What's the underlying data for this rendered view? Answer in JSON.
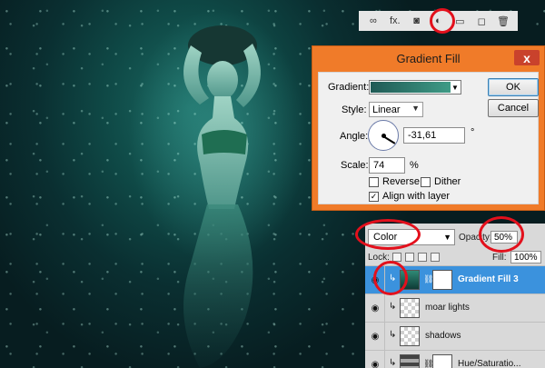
{
  "toolbar": {
    "icons": [
      "link-icon",
      "fx-icon",
      "mask-icon",
      "adjustment-icon",
      "folder-icon",
      "new-layer-icon",
      "trash-icon"
    ],
    "fx_label": "fx."
  },
  "dialog": {
    "title": "Gradient Fill",
    "close_label": "x",
    "gradient_label": "Gradient:",
    "style_label": "Style:",
    "style_value": "Linear",
    "angle_label": "Angle:",
    "angle_value": "-31,61",
    "degree_symbol": "°",
    "scale_label": "Scale:",
    "scale_value": "74",
    "percent_symbol": "%",
    "reverse_label": "Reverse",
    "dither_label": "Dither",
    "align_label": "Align with layer",
    "reverse_checked": false,
    "dither_checked": false,
    "align_checked": true,
    "ok_label": "OK",
    "cancel_label": "Cancel",
    "gradient_colors": [
      "#1f5a55",
      "#3f9b86"
    ]
  },
  "layers": {
    "blend_mode": "Color",
    "opacity_label": "Opacity:",
    "opacity_value": "50%",
    "lock_label": "Lock:",
    "fill_label": "Fill:",
    "fill_value": "100%",
    "rows": [
      {
        "name": "Gradient Fill 3",
        "active": true
      },
      {
        "name": "moar lights",
        "active": false
      },
      {
        "name": "shadows",
        "active": false
      },
      {
        "name": "Hue/Saturatio...",
        "active": false
      }
    ]
  },
  "colors": {
    "dialog_title_bar": "#f07b29",
    "highlight_ring": "#e3101c",
    "active_layer": "#3b92dd"
  }
}
